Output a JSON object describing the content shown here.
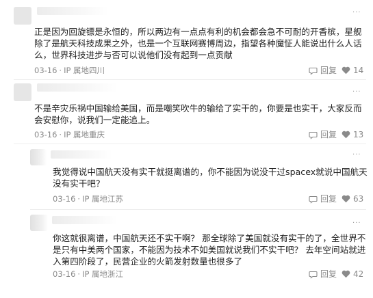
{
  "comments": [
    {
      "text": "正是因为回旋镖是永恒的，所以两边有一点点有利的机会都会急不可耐的开香槟，星舰除了是航天科技成果之外，也是一个互联网赛博周边，指望各种魔怔人能说出什么人话么，世界科技进步与否可以说他们没有起到一点贡献",
      "date": "03-16",
      "ip": "IP 属地四川",
      "reply_label": "回复",
      "likes": "14"
    },
    {
      "text": "不是辛灾乐祸中国输给美国，而是嘲笑吹牛的输给了实干的，你要是也实干，大家反而会安慰你，说我们一定能追上。",
      "date": "03-16",
      "ip": "IP 属地重庆",
      "reply_label": "回复",
      "likes": "13"
    },
    {
      "text": "我觉得说中国航天没有实干就挺离谱的，你不能因为说没干过spacex就说中国航天没有实干吧？",
      "date": "03-16",
      "ip": "IP 属地江苏",
      "reply_label": "回复",
      "likes": "63"
    },
    {
      "text": "你这就很离谱，中国航天还不实干啊？ 那全球除了美国就没有实干的了，全世界不是只有中美两个国家，不能因为技术不如美国就说我们不实干吧？ 去年空间站就进入第四阶段了，民营企业的火箭发射数量也很多了",
      "date": "03-16",
      "ip": "IP 属地浙江",
      "reply_label": "回复",
      "likes": "42"
    }
  ],
  "icons": {
    "more": "more-dots-icon",
    "reply": "reply-bubble-icon",
    "like": "heart-icon"
  }
}
